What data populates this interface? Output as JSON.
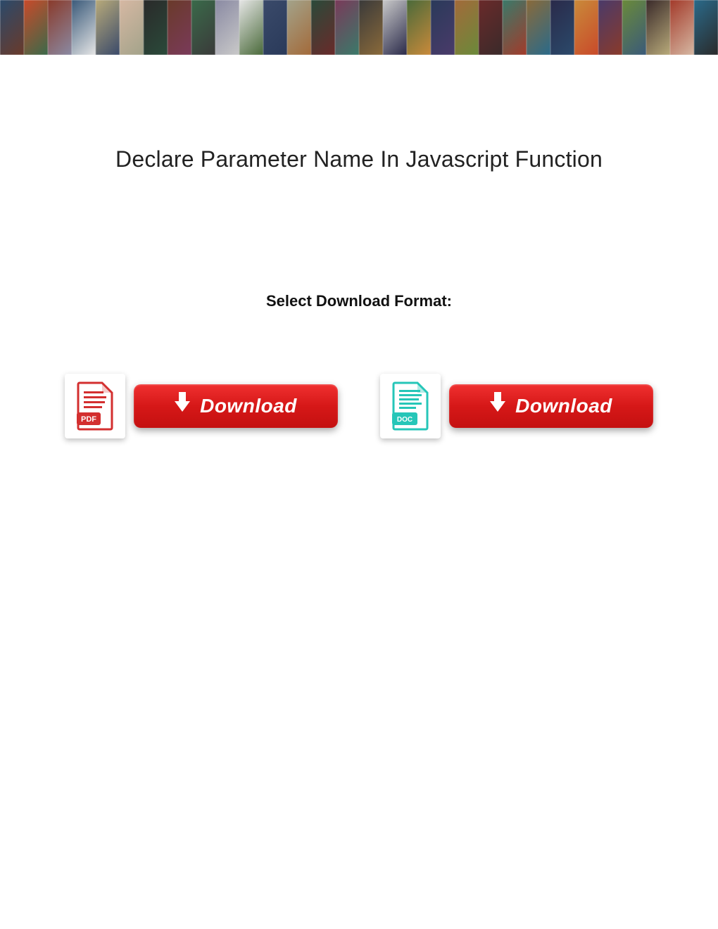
{
  "title": "Declare Parameter Name In Javascript Function",
  "subtitle": "Select Download Format:",
  "pdf_icon_label": "PDF",
  "doc_icon_label": "DOC",
  "download_button_label": "Download",
  "banner_tiles": [
    "#2b4a6b",
    "#c94a2a",
    "#8a3a2a",
    "#3a5a7a",
    "#b8aa7a",
    "#d6b8a3",
    "#2a2a2a",
    "#6a3a2a",
    "#3a6a4a",
    "#8a8aa3",
    "#e6e6e6",
    "#3a4a6a",
    "#a3a38a",
    "#2a4a3a",
    "#7a3a5a",
    "#3a3a3a",
    "#c9c9c9",
    "#4a6a3a",
    "#2a3a5a",
    "#a36a3a",
    "#6a2a2a",
    "#3a7a6a",
    "#8a6a3a",
    "#2a2a4a",
    "#c98a3a",
    "#4a3a6a",
    "#6a8a3a",
    "#3a2a2a",
    "#a33a2a",
    "#2a6a8a"
  ]
}
